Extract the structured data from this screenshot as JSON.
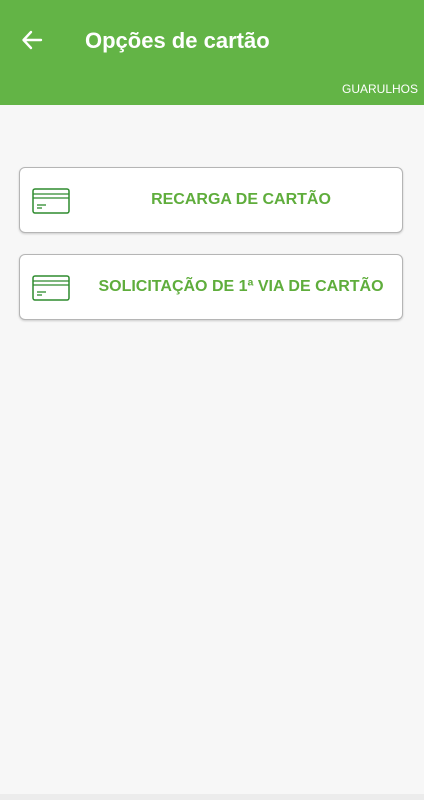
{
  "header": {
    "title": "Opções de cartão",
    "city": "GUARULHOS",
    "back_icon": "arrow-left-icon",
    "background_color": "#63b446"
  },
  "options": [
    {
      "label": "RECARGA DE CARTÃO",
      "icon": "credit-card-icon"
    },
    {
      "label": "SOLICITAÇÃO DE 1ª VIA DE CARTÃO",
      "icon": "credit-card-icon"
    }
  ],
  "colors": {
    "accent": "#5fad3c",
    "icon": "#2e8b2e",
    "page_background": "#f7f7f7"
  }
}
